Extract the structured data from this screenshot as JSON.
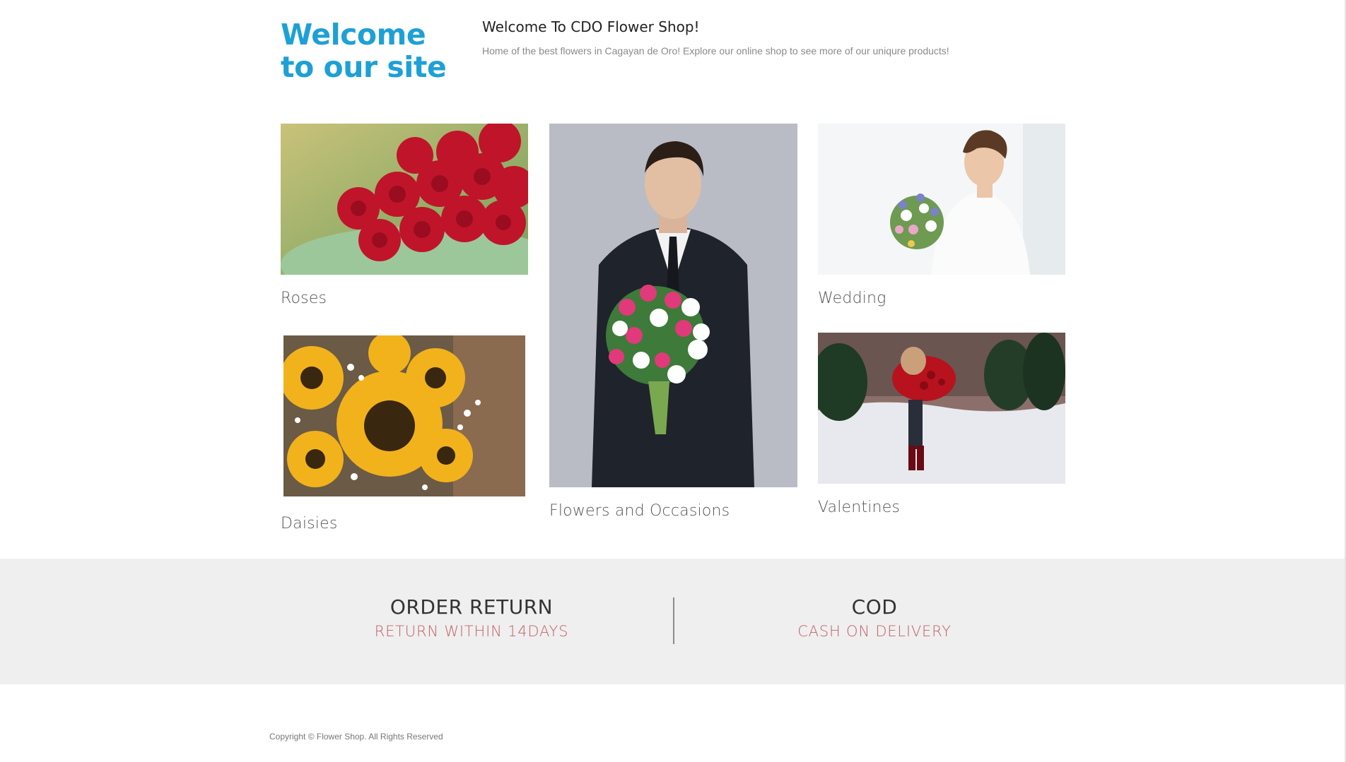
{
  "header": {
    "welcome_big": "Welcome to our site",
    "title": "Welcome To CDO Flower Shop!",
    "description": "Home of the best flowers in Cagayan de Oro! Explore our online shop to see more of our uniqure products!"
  },
  "gallery": {
    "roses": "Roses",
    "daisies": "Daisies",
    "occasions": "Flowers and Occasions",
    "wedding": "Wedding",
    "valentines": "Valentines"
  },
  "features": {
    "order_return_title": "ORDER RETURN",
    "order_return_sub": "RETURN WITHIN 14DAYS",
    "cod_title": "COD",
    "cod_sub": "CASH ON DELIVERY"
  },
  "footer": {
    "copyright": "Copyright © Flower Shop. All Rights Reserved"
  },
  "colors": {
    "accent": "#1ea0d6",
    "feature_sub": "#c0646a",
    "band_bg": "#efefef"
  }
}
